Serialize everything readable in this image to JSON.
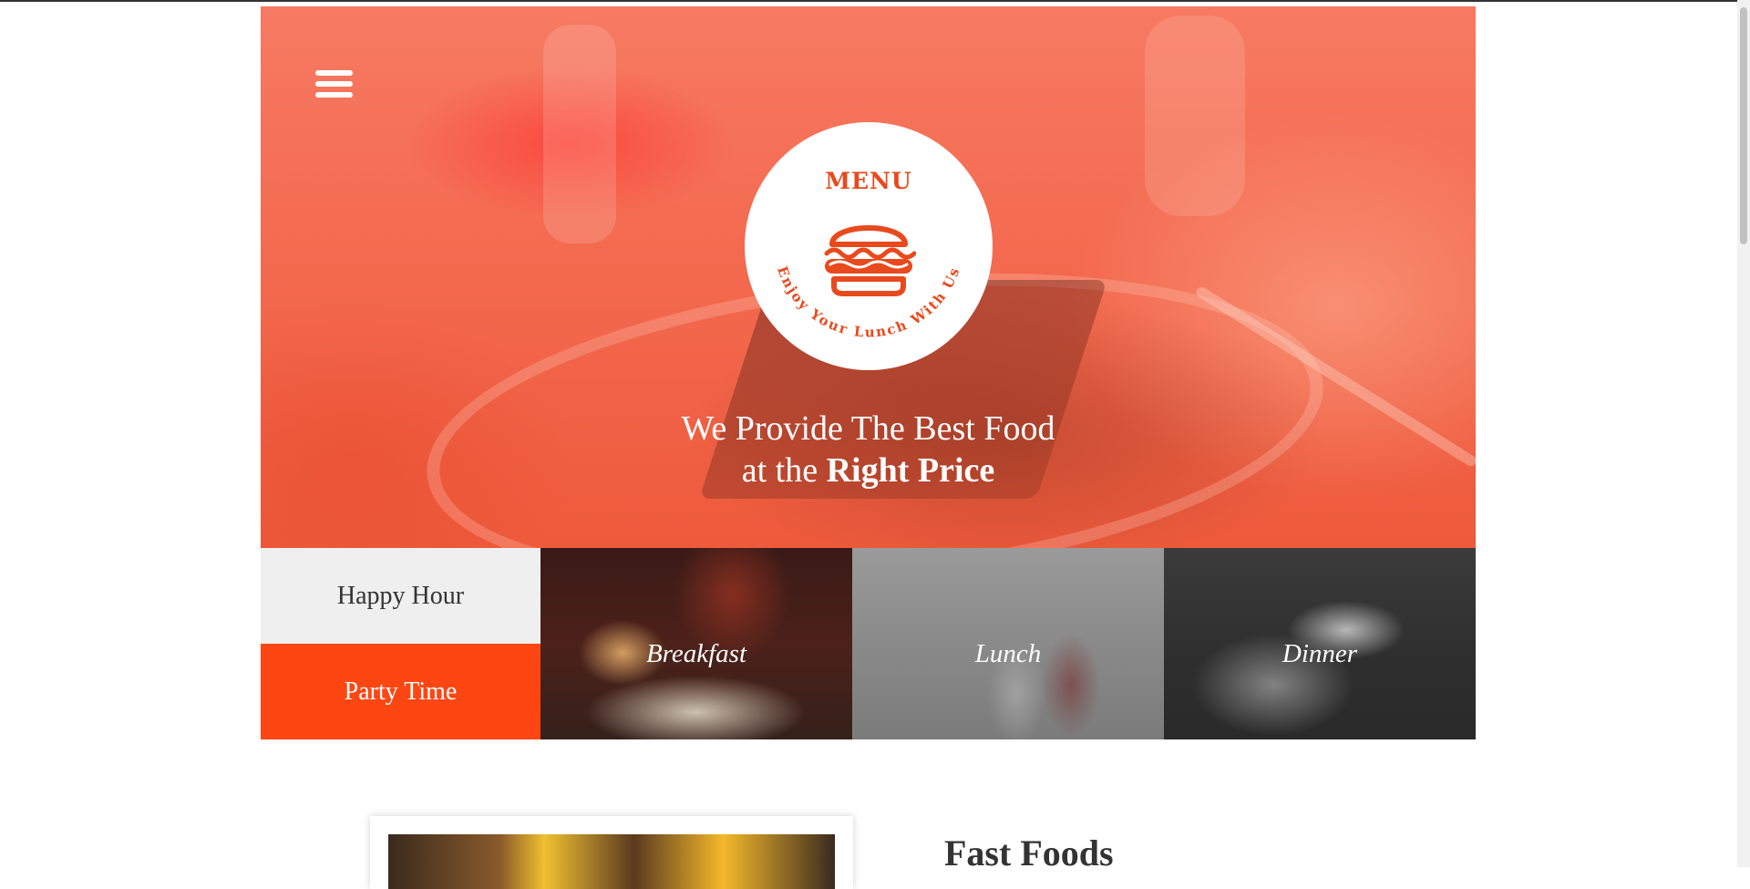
{
  "nav": {
    "menu_icon": "hamburger-menu-icon"
  },
  "badge": {
    "title": "MENU",
    "icon": "burger-icon",
    "tagline": "Enjoy Your Lunch With Us",
    "accent_color": "#e8491d"
  },
  "hero": {
    "line1": "We Provide The Best Food",
    "line2_prefix": "at the",
    "line2_emphasis": "Right Price"
  },
  "categories": {
    "happy_hour": "Happy Hour",
    "party_time": "Party Time",
    "breakfast": "Breakfast",
    "lunch": "Lunch",
    "dinner": "Dinner"
  },
  "section": {
    "title": "Fast Foods"
  },
  "colors": {
    "brand_orange": "#fd4612",
    "hero_overlay": "#f46c52",
    "light_tile": "#efefef"
  }
}
